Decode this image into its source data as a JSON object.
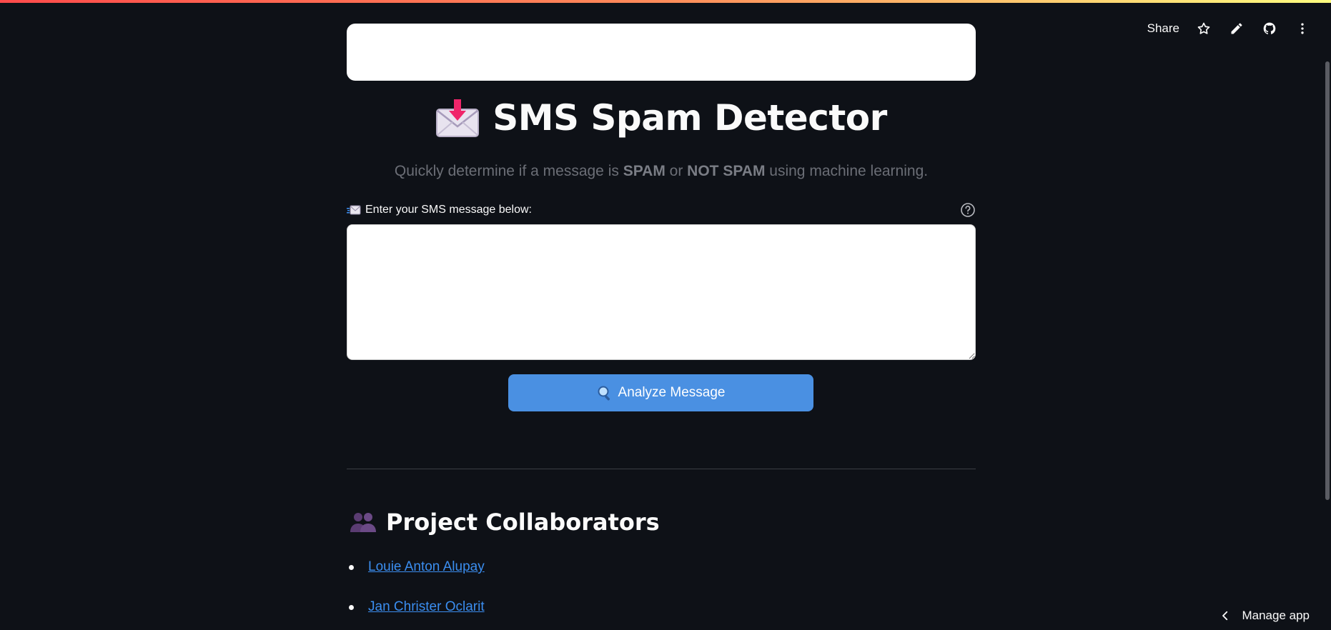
{
  "toolbar": {
    "share_label": "Share",
    "icons": [
      "star-icon",
      "pencil-icon",
      "github-icon",
      "more-vertical-icon"
    ]
  },
  "header": {
    "title": "SMS Spam Detector",
    "title_icon": "envelope-with-arrow-icon",
    "subtitle_prefix": "Quickly determine if a message is ",
    "subtitle_spam": "SPAM",
    "subtitle_or": " or ",
    "subtitle_not_spam": "NOT SPAM",
    "subtitle_suffix": " using machine learning."
  },
  "input": {
    "label": "Enter your SMS message below:",
    "label_icon": "incoming-envelope-icon",
    "value": "",
    "help_icon": "question-circle-icon"
  },
  "analyze_button": {
    "label": "Analyze Message",
    "icon": "magnifying-glass-icon"
  },
  "collaborators": {
    "heading": "Project Collaborators",
    "heading_icon": "people-silhouette-icon",
    "items": [
      {
        "name": "Louie Anton Alupay"
      },
      {
        "name": "Jan Christer Oclarit"
      }
    ]
  },
  "footer": {
    "manage_label": "Manage app"
  },
  "colors": {
    "background": "#0e1117",
    "accent_button": "#4a90e2",
    "link": "#3b8ef0"
  }
}
